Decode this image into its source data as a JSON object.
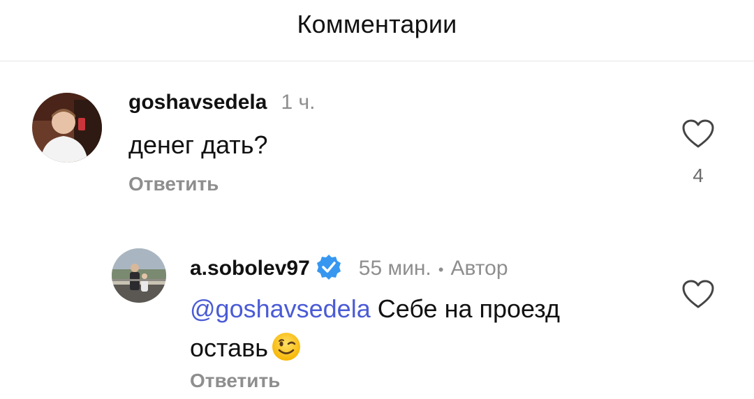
{
  "header": {
    "title": "Комментарии"
  },
  "comments": [
    {
      "username": "goshavsedela",
      "time": "1 ч.",
      "text": "денег дать?",
      "reply_label": "Ответить",
      "like_count": "4",
      "avatar_icon": "user-avatar"
    },
    {
      "username": "a.sobolev97",
      "verified": true,
      "time": "55 мин.",
      "separator": "•",
      "author_badge": "Автор",
      "mention": "@goshavsedela",
      "text": " Себе на проезд оставь",
      "emoji": "winking-face",
      "reply_label": "Ответить",
      "avatar_icon": "user-avatar"
    }
  ],
  "colors": {
    "mention": "#4a5bd6",
    "verified": "#3797f0",
    "secondary_text": "#8e8e8e"
  }
}
